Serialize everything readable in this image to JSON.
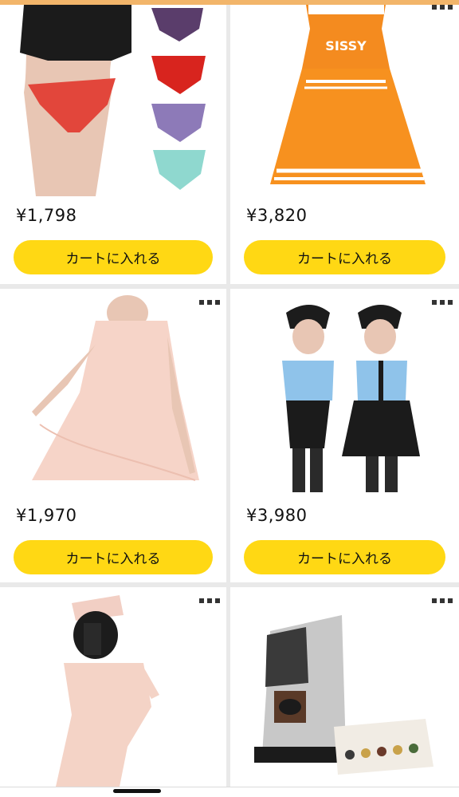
{
  "products": [
    {
      "price": "¥1,798",
      "cart_label": "カートに入れる",
      "image_name": "lingerie-panties-product-image",
      "image_text": ""
    },
    {
      "price": "¥3,820",
      "cart_label": "カートに入れる",
      "image_name": "cheerleader-dress-product-image",
      "image_text": "SISSY"
    },
    {
      "price": "¥1,970",
      "cart_label": "カートに入れる",
      "image_name": "pink-babydoll-dress-product-image",
      "image_text": ""
    },
    {
      "price": "¥3,980",
      "cart_label": "カートに入れる",
      "image_name": "police-costume-product-image",
      "image_text": ""
    },
    {
      "price": "",
      "cart_label": "",
      "image_name": "nurse-costume-product-image",
      "image_text": ""
    },
    {
      "price": "",
      "cart_label": "",
      "image_name": "nespresso-coffee-machine-product-image",
      "image_text": ""
    }
  ],
  "icons": {
    "more": "more-options-icon"
  },
  "colors": {
    "cart_button": "#ffd814",
    "background": "#e9e9e9",
    "card": "#ffffff",
    "top_accent": "#f2b56a"
  }
}
